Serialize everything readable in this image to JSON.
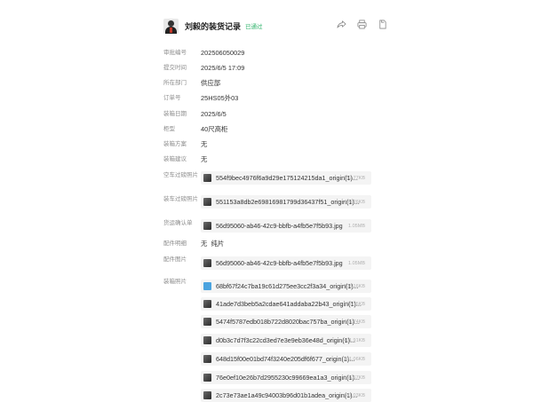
{
  "header": {
    "title": "刘毅的装货记录",
    "status": "已通过"
  },
  "fields": [
    {
      "label": "审批编号",
      "value": "202506050029"
    },
    {
      "label": "提交时间",
      "value": "2025/6/5 17:09"
    },
    {
      "label": "所在部门",
      "value": "供应部"
    },
    {
      "label": "订单号",
      "value": "25HS05外03"
    },
    {
      "label": "装箱日期",
      "value": "2025/6/5"
    },
    {
      "label": "柜型",
      "value": "40尺高柜"
    },
    {
      "label": "装箱方案",
      "value": "无"
    },
    {
      "label": "装箱建议",
      "value": "无"
    }
  ],
  "empty_truck_weigh": {
    "label": "空车过磅照片",
    "file": {
      "name": "554f9bec4976f6a9d29e175124215da1_origin(1)...",
      "size": "552.77KB"
    }
  },
  "loaded_truck_weigh": {
    "label": "装车过磅照片",
    "file": {
      "name": "551153a8db2e69816981799d36437f51_origin(1)...",
      "size": "404.26KB"
    }
  },
  "delivery_confirmation": {
    "label": "货运确认单",
    "file": {
      "name": "56d95060-ab46-42c9-bbfb-a4fb5e7f5b93.jpg",
      "size": "1.05MB"
    }
  },
  "parts_detail": {
    "label": "配件明细",
    "value": "无  纯片"
  },
  "parts_photo": {
    "label": "配件图片",
    "file": {
      "name": "56d95060-ab46-42c9-bbfb-a4fb5e7f5b93.jpg",
      "size": "1.05MB"
    }
  },
  "loading_photos": {
    "label": "装箱照片",
    "files": [
      {
        "name": "68bf67f24c7ba19c61d275ee3cc2f3a34_origin(1)...",
        "size": "398.16KB",
        "icon": "document-icon"
      },
      {
        "name": "41ade7d3beb5a2cdae641addaba22b43_origin(1)...",
        "size": "537.55KB",
        "icon": "image-icon"
      },
      {
        "name": "5474f5787edb018b722d8020bac757ba_origin(1)...",
        "size": "465.74KB",
        "icon": "image-icon"
      },
      {
        "name": "d0b3c7d7f3c22cd3ed7e3e9eb36e48d_origin(1)...",
        "size": "401.91KB",
        "icon": "image-icon"
      },
      {
        "name": "648d15f00e01bd74f3240e205df6f677_origin(1)...",
        "size": "381.06KB",
        "icon": "image-icon"
      },
      {
        "name": "76e0ef10e26b7d2955230c99669ea1a3_origin(1)...",
        "size": "566.67KB",
        "icon": "image-icon"
      },
      {
        "name": "2c73e73ae1a49c94003b96d01b1adea_origin(1)...",
        "size": "481.03KB",
        "icon": "image-icon"
      }
    ]
  },
  "icons": {
    "share": "share-icon",
    "print": "print-icon",
    "copy": "copy-icon"
  },
  "colors": {
    "status_green": "#2fb36b",
    "label_gray": "#8c8c8c",
    "file_bg": "#f4f4f4"
  }
}
